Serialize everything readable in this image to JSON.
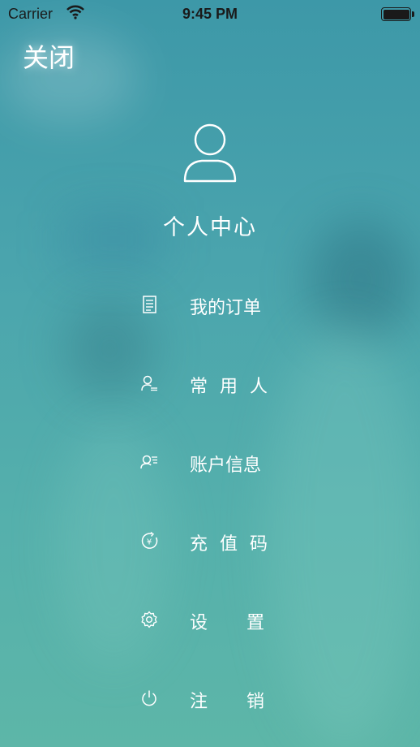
{
  "status_bar": {
    "carrier": "Carrier",
    "time": "9:45 PM"
  },
  "header": {
    "close_label": "关闭"
  },
  "profile": {
    "title": "个人中心",
    "icon": "user-avatar-icon"
  },
  "menu": {
    "items": [
      {
        "label": "我的订单",
        "icon": "order-list-icon"
      },
      {
        "label": "常用人",
        "icon": "frequent-contacts-icon"
      },
      {
        "label": "账户信息",
        "icon": "account-info-icon"
      },
      {
        "label": "充值码",
        "icon": "recharge-code-icon"
      },
      {
        "label": "设置",
        "icon": "settings-gear-icon"
      },
      {
        "label": "注销",
        "icon": "power-logout-icon"
      }
    ]
  },
  "colors": {
    "background_top": "#3d98a8",
    "background_bottom": "#5db6a8",
    "foreground": "#ffffff"
  }
}
